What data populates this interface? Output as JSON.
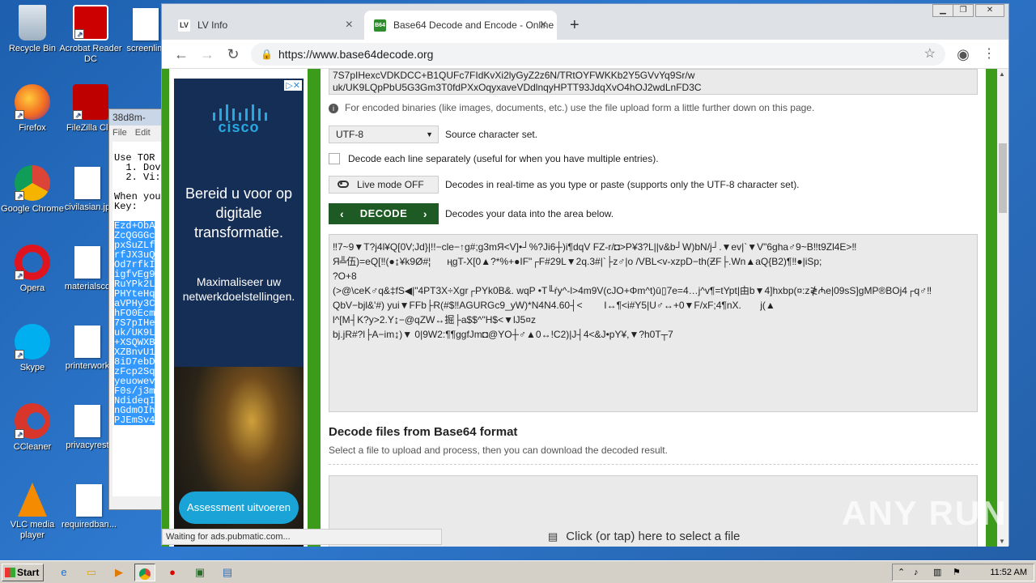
{
  "desktop": {
    "icons": [
      {
        "label": "Recycle Bin"
      },
      {
        "label": "Acrobat Reader DC"
      },
      {
        "label": "screenlim"
      },
      {
        "label": "Firefox"
      },
      {
        "label": "FileZilla Clie"
      },
      {
        "label": "Google Chrome"
      },
      {
        "label": "civilasian.jp"
      },
      {
        "label": "Opera"
      },
      {
        "label": "materialsco"
      },
      {
        "label": "Skype"
      },
      {
        "label": "printerwork"
      },
      {
        "label": "CCleaner"
      },
      {
        "label": "privacyrest"
      },
      {
        "label": "VLC media player"
      },
      {
        "label": "requiredban..."
      }
    ],
    "watermark": "ANY RUN"
  },
  "notepad": {
    "title": "38d8m-",
    "menu": [
      "File",
      "Edit"
    ],
    "text": "Use TOR\n  1. Dov\n  2. Vi:\n\nWhen you\nKey:",
    "selected_lines": [
      "Ezd+ObA",
      "ZcQGGGc",
      "pxSuZLf",
      "rfJX3uQ",
      "Od7rfkI",
      "igfvEg9",
      "RuYPk2L",
      "PHYteHq",
      "aVPHy3C",
      "hFO0Ecm",
      "7S7pIHe",
      "uk/UK9L",
      "+XSQWXB",
      "XZBnvU1",
      "8iD7ebD",
      "zFcp2Sq",
      "yeuowev",
      "F0s/j3m",
      "NdideqI",
      "nGdmOIh",
      "PJEmSv4"
    ]
  },
  "browser": {
    "tabs": [
      {
        "label": "LV Info",
        "favicon": "LV",
        "active": false
      },
      {
        "label": "Base64 Decode and Encode - Online",
        "favicon": "B64",
        "active": true
      }
    ],
    "new_tab": "+",
    "url": "https://www.base64decode.org",
    "status": "Waiting for ads.pubmatic.com..."
  },
  "ad": {
    "brand": "cisco",
    "headline": "Bereid u voor op digitale transformatie.",
    "subline": "Maximaliseer uw netwerkdoelstellingen.",
    "button": "Assessment uitvoeren"
  },
  "page": {
    "input_text": "7S7pIHexcVDKDCC+B1QUFc7FIdKvXi2lyGyZ2z6N/TRtOYFWKKb2Y5GVvYq9Sr/w\nuk/UK9LQpPbU5G3Gm3T0fdPXxOqyxaveVDdlnqyHPTT93JdqXvO4hOJ2wdLnFD3C",
    "info_text": "For encoded binaries (like images, documents, etc.) use the file upload form a little further down on this page.",
    "charset_value": "UTF-8",
    "charset_label": "Source character set.",
    "each_line_label": "Decode each line separately (useful for when you have multiple entries).",
    "live_mode_label": "Live mode OFF",
    "live_mode_desc": "Decodes in real-time as you type or paste (supports only the UTF-8 character set).",
    "decode_label": "DECODE",
    "decode_desc": "Decodes your data into the area below.",
    "output_text": "‼7~9▼T?j4l¥Q[0V;Jd}|!!−cle−↑g#;g3mЯ<V]•┘%?Ji6┼)i¶dqV FZ-r/◘>P¥3?L||v&b┘W)bN/j┘.▼ev|`▼V\"6gha♂9~B‼t9Zl4E>‼\nЯ╩伍)=eQ[‼(●↨¥k9Ø#¦      ңgT-X[0▲?*%+●IF\"┌F#29L▼2q.3#|`├z♂|o /VBL<v-xzpD−th(ƵF├.Wn▲aQ{B2)¶‼●|iSp;\n?O+8\n(>@\\ceK♂q&‡fS◀|\"4PT3X÷Xgr┌PYk0B&. wqP •T╙ŕy^-l>4m9V(cJO+Φm^t)ū▯7e=4…j^v¶=tYpt|由b▼4]hxbp(¤:z≹₼e|09sS]gMP®BOj4┌q♂‼\nQbV−bjl&'#) yui▼FFb├R(#$‼AGURGc9_yW)*N4N4.60┤<        I↔¶<i#Y5|U♂↔+0▼F/xF;4¶nX.       j(▲\nl^[M┤K?y>2.Y↨−@qZW↔掘├a$$^\"H$<▼lJ5¤z\nbj.jR#?l├A−im↨)▼ 0|9W2:¶¶ggfJm◘@YO┼♂▲0↔!C2)|J┤4<&J•pY¥,▼?h0T┬7",
    "decode_files_title": "Decode files from Base64 format",
    "decode_files_sub": "Select a file to upload and process, then you can download the decoded result.",
    "upload_label": "Click (or tap) here to select a file"
  },
  "taskbar": {
    "start": "Start",
    "clock": "11:52 AM"
  },
  "colors": {
    "green_bar": "#3d9b1c",
    "decode_button": "#1e5a23",
    "ad_bg": "#152e55"
  }
}
